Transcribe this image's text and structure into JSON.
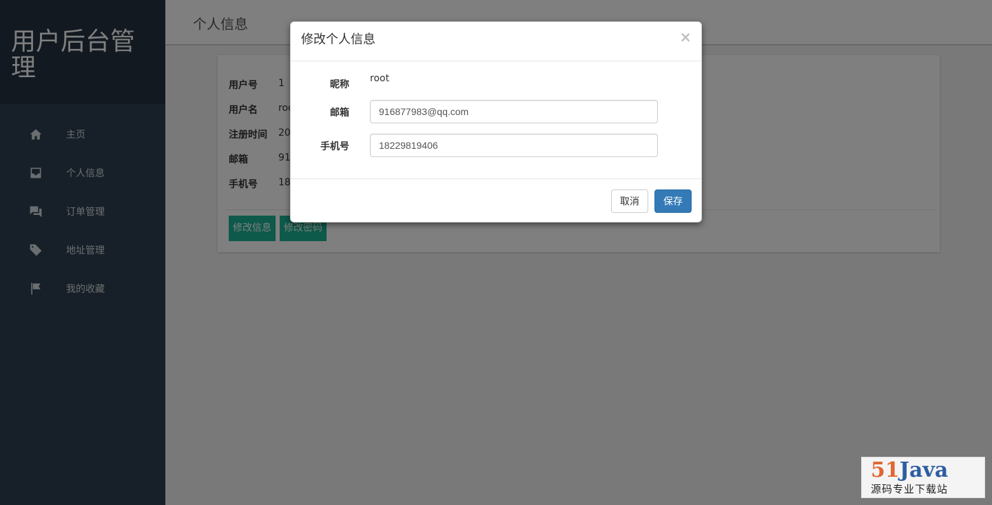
{
  "sidebar": {
    "brand": "用户后台管理",
    "items": [
      {
        "label": "主页",
        "icon": "home-icon"
      },
      {
        "label": "个人信息",
        "icon": "inbox-icon"
      },
      {
        "label": "订单管理",
        "icon": "chat-icon"
      },
      {
        "label": "地址管理",
        "icon": "tag-icon"
      },
      {
        "label": "我的收藏",
        "icon": "flag-icon"
      }
    ]
  },
  "header": {
    "title": "个人信息"
  },
  "profile": {
    "rows": [
      {
        "label": "用户号",
        "value": "1"
      },
      {
        "label": "用户名",
        "value": "roc"
      },
      {
        "label": "注册时间",
        "value": "20"
      },
      {
        "label": "邮箱",
        "value": "91"
      },
      {
        "label": "手机号",
        "value": "18"
      }
    ],
    "edit_button": "修改信息",
    "password_button": "修改密码"
  },
  "modal": {
    "title": "修改个人信息",
    "close": "×",
    "nickname_label": "昵称",
    "nickname_value": "root",
    "email_label": "邮箱",
    "email_value": "916877983@qq.com",
    "phone_label": "手机号",
    "phone_value": "18229819406",
    "cancel_label": "取消",
    "save_label": "保存"
  },
  "watermark": {
    "logo_num": "51",
    "logo_text": "Java",
    "subtitle": "源码专业下载站"
  },
  "colors": {
    "sidebar": "#2f4050",
    "brand_bg": "#253340",
    "accent": "#1ab394",
    "primary": "#337ab7"
  }
}
